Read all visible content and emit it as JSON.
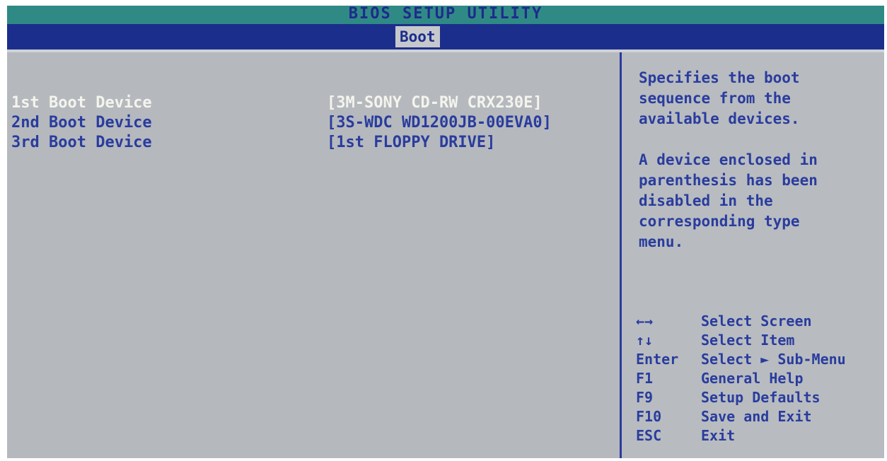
{
  "title": "BIOS SETUP UTILITY",
  "active_tab": "Boot",
  "boot_devices": [
    {
      "label": "1st Boot Device",
      "value": "[3M-SONY CD-RW CRX230E]"
    },
    {
      "label": "2nd Boot Device",
      "value": "[3S-WDC WD1200JB-00EVA0]"
    },
    {
      "label": "3rd Boot Device",
      "value": "[1st FLOPPY DRIVE]"
    }
  ],
  "help": {
    "paragraph1": [
      "Specifies the boot",
      "sequence from the",
      "available devices."
    ],
    "paragraph2": [
      "A device enclosed in",
      "parenthesis has been",
      "disabled in the",
      "corresponding type",
      "menu."
    ]
  },
  "keys": [
    {
      "key": "←→",
      "desc": "Select Screen"
    },
    {
      "key": "↑↓",
      "desc": "Select Item"
    },
    {
      "key": "Enter",
      "desc": "Select ► Sub-Menu"
    },
    {
      "key": "F1",
      "desc": "General Help"
    },
    {
      "key": "F9",
      "desc": "Setup Defaults"
    },
    {
      "key": "F10",
      "desc": "Save and Exit"
    },
    {
      "key": "ESC",
      "desc": "Exit"
    }
  ],
  "colors": {
    "title_bar": "#2f8a86",
    "menu_bar": "#1c2e8c",
    "panel_background": "#b5b9bd",
    "text_blue": "#2a3c9e",
    "selected_text": "#f4f4ee"
  }
}
